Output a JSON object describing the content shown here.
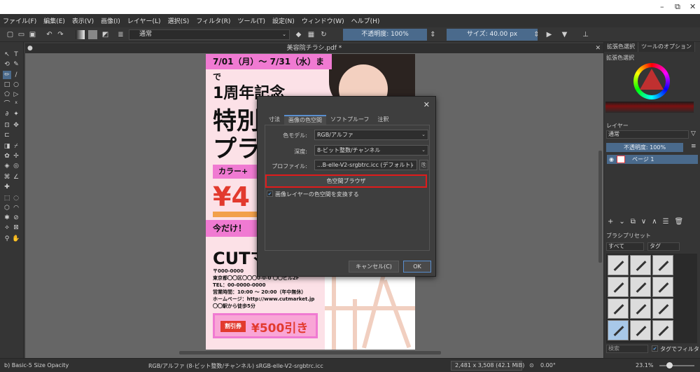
{
  "titlebar": {
    "minimize": "–",
    "restore": "⧉",
    "close": "✕"
  },
  "menu": [
    "ファイル(F)",
    "編集(E)",
    "表示(V)",
    "画像(I)",
    "レイヤー(L)",
    "選択(S)",
    "フィルタ(R)",
    "ツール(T)",
    "設定(N)",
    "ウィンドウ(W)",
    "ヘルプ(H)"
  ],
  "toolbar": {
    "blend_mode": "通常",
    "opacity": "不透明度: 100%",
    "size": "サイズ: 40.00 px"
  },
  "document": {
    "tab_title": "美容院チラシ.pdf *"
  },
  "flyer": {
    "date": "7/01（月）～ 7/31（水）まで",
    "line1": "1周年記念",
    "line2": "特別",
    "line3": "プラ",
    "color_bar": "カラー+",
    "price": "¥4",
    "today": "今だけ！",
    "cut": "CUTマ",
    "zip": "〒000-0000",
    "address": "東京都〇〇区〇〇〇0-0-0 〇〇ビル2F",
    "tel": "TEL：00-0000-0000",
    "hours": "営業時間：10:00 ～ 20:00（年中無休）",
    "homepage": "ホームページ：http://www.cutmarket.jp",
    "access": "〇〇駅から徒歩5分",
    "coupon_tag": "割引券",
    "coupon_amount": "¥500引き"
  },
  "dialog": {
    "close": "✕",
    "tabs": [
      "寸法",
      "画像の色空間",
      "ソフトプルーフ",
      "注釈"
    ],
    "color_model_label": "色モデル:",
    "color_model": "RGB/アルファ",
    "depth_label": "深度:",
    "depth": "8-ビット整数/チャンネル",
    "profile_label": "プロファイル:",
    "profile": "...B-elle-V2-srgbtrc.icc (デフォルト)",
    "colorspace_browser": "色空間ブラウザ",
    "convert_check": "画像レイヤーの色空間を変換する",
    "cancel": "キャンセル(C)",
    "ok": "OK"
  },
  "dock": {
    "tabs": [
      "拡張色選択",
      "ツールのオプション"
    ],
    "color_selector": "拡張色選択",
    "layers_title": "レイヤー",
    "layer_blend": "通常",
    "layer_opacity": "不透明度: 100%",
    "layer_name": "ページ 1",
    "brush_title": "ブラシプリセット",
    "brush_filter": "すべて",
    "brush_tag": "タグ",
    "search": "検索",
    "filter_by_tag": "タグでフィルタ"
  },
  "status": {
    "brush": "b) Basic-5 Size Opacity",
    "colorspace": "RGB/アルファ (8-ビット整数/チャンネル)  sRGB-elle-V2-srgbtrc.icc",
    "dimensions": "2,481 x 3,508 (42.1 MiB)",
    "rotation": "0.00°",
    "zoom": "23.1%"
  }
}
